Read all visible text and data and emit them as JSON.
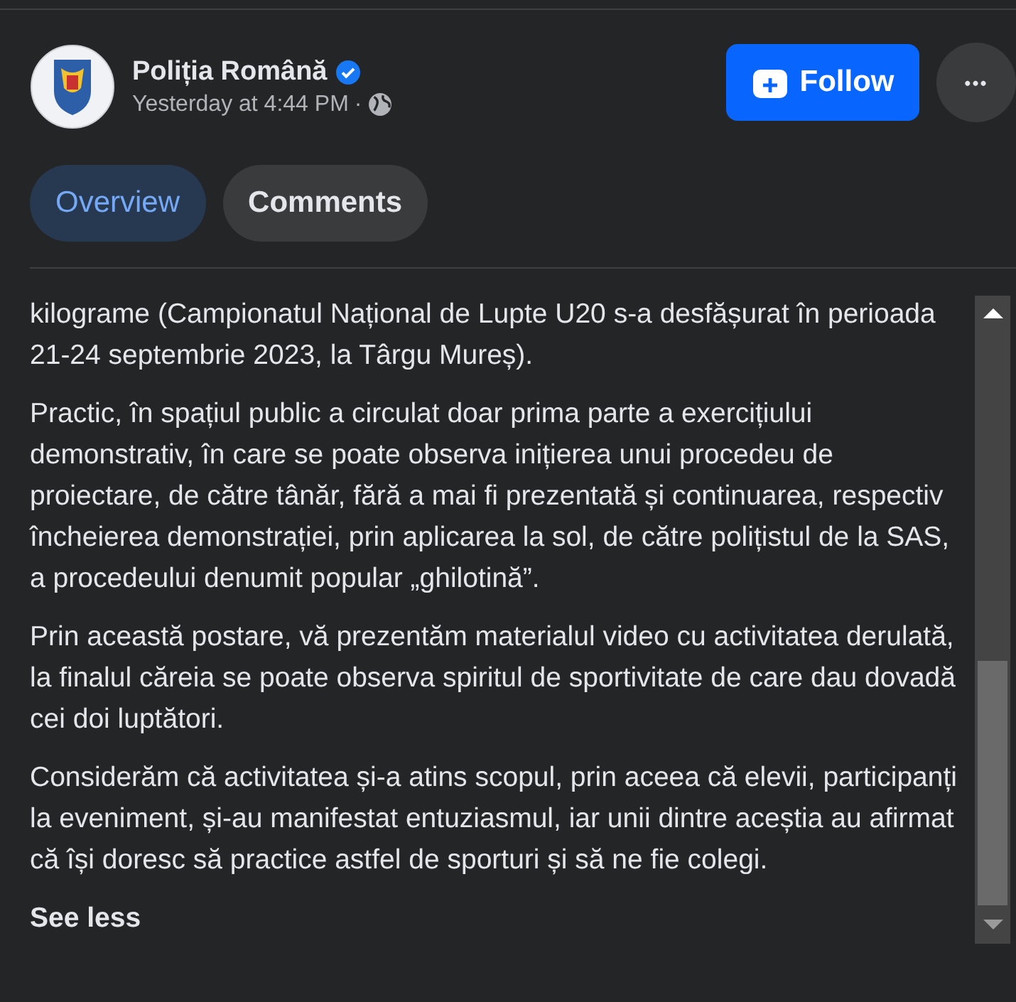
{
  "post": {
    "author": "Poliția Română",
    "verified": true,
    "time": "Yesterday at 4:44 PM",
    "separator": "·",
    "follow_label": "Follow",
    "more_label": "•••"
  },
  "tabs": [
    {
      "label": "Overview",
      "selected": true
    },
    {
      "label": "Comments",
      "selected": false
    }
  ],
  "body": {
    "paragraphs": [
      "kilograme (Campionatul Național de Lupte U20 s-a desfășurat în perioada 21-24 septembrie 2023, la Târgu Mureș).",
      "Practic, în spațiul public a circulat doar prima parte a exercițiului demonstrativ, în care se poate observa inițierea unui procedeu de proiectare, de către tânăr, fără a mai fi prezentată și continuarea, respectiv încheierea demonstrației, prin aplicarea la sol, de către polițistul de la SAS, a procedeului denumit popular „ghilotină”.",
      "Prin această postare, vă prezentăm materialul video cu activitatea derulată, la finalul căreia se poate observa spiritul de sportivitate de care dau dovadă cei doi luptători.",
      "Considerăm că activitatea și-a atins scopul, prin aceea că elevii, participanți la eveniment, și-au manifestat entuziasmul, iar unii dintre aceștia au afirmat că își doresc să practice astfel de sporturi și să ne fie colegi."
    ],
    "see_less": "See less"
  }
}
